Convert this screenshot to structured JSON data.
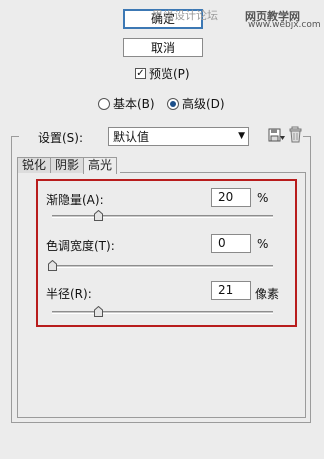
{
  "buttons": {
    "ok": "确定",
    "cancel": "取消"
  },
  "watermark": {
    "text": "思缘设计论坛",
    "site": "网页教学网",
    "url": "www.webjx.com"
  },
  "preview": {
    "label": "预览(P)",
    "checked": true
  },
  "mode": {
    "basic": "基本(B)",
    "advanced": "高级(D)",
    "selected": "advanced"
  },
  "settings": {
    "label": "设置(S):",
    "value": "默认值"
  },
  "icons": [
    "save-settings-icon",
    "delete-settings-icon"
  ],
  "tabs": [
    "锐化",
    "阴影",
    "高光"
  ],
  "active_tab": "高光",
  "params": {
    "fade": {
      "label": "渐隐量(A):",
      "value": "20",
      "unit": "%",
      "slider": 0.2
    },
    "tonal_width": {
      "label": "色调宽度(T):",
      "value": "0",
      "unit": "%",
      "slider": 0.0
    },
    "radius": {
      "label": "半径(R):",
      "value": "21",
      "unit": "像素",
      "slider": 0.2
    }
  },
  "colors": {
    "highlight_box": "#b81c1c",
    "focus": "#3c78b4"
  }
}
